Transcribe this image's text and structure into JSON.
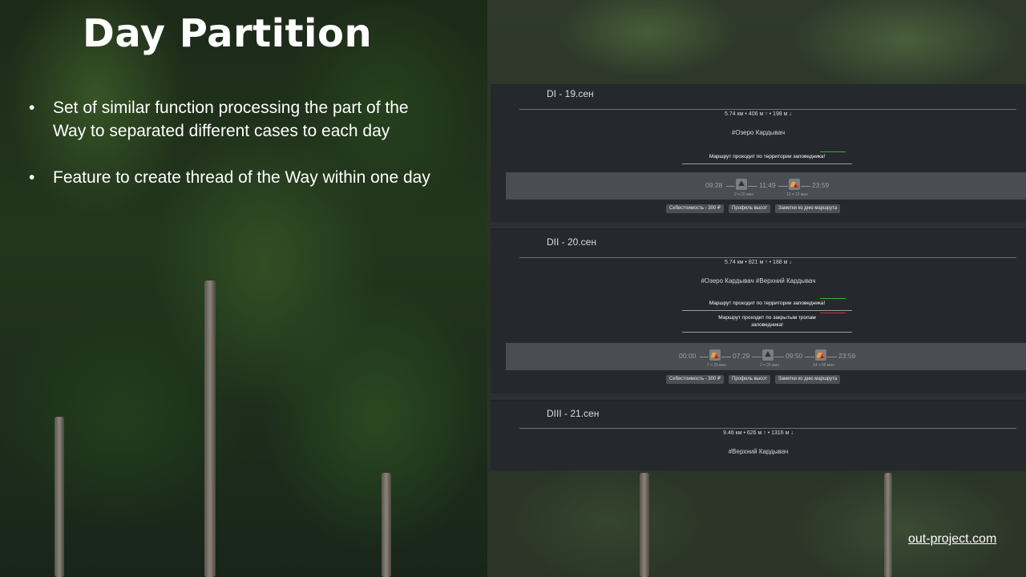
{
  "slide": {
    "title": "Day Partition",
    "bullets": [
      "Set of similar function processing the part of the Way to separated different cases to each day",
      "Feature to create thread of the Way within one day"
    ],
    "link": "out-project.com"
  },
  "screenshot": {
    "days": [
      {
        "title": "DI - 19.сен",
        "stats": "5.74 км • 406 м ↑ • 198 м ↓",
        "tags": "#Озеро Кардывач",
        "warnings": [
          {
            "text": "Маршрут проходит по территории заповедника!",
            "mark_color": "#3fae49"
          }
        ],
        "timeline": {
          "times": [
            "09:28",
            "11:49",
            "23:59"
          ],
          "durations": [
            "2 ч 20 мин",
            "12 ч 10 мин"
          ]
        },
        "buttons": [
          "Себестоимость - 300 ₽",
          "Профиль высот",
          "Заметки ко дню маршрута"
        ]
      },
      {
        "title": "DII - 20.сен",
        "stats": "5.74 км • 821 м ↑ • 188 м ↓",
        "tags": "#Озеро Кардывач #Верхний Кардывач",
        "warnings": [
          {
            "text": "Маршрут проходит по территории заповедника!",
            "mark_color": "#3fae49"
          },
          {
            "text": "Маршрут проходит по закрытым тропам заповедника!",
            "mark_color": "#c0392b"
          }
        ],
        "timeline": {
          "times": [
            "00:00",
            "07:29",
            "09:50",
            "23:59"
          ],
          "durations": [
            "7 ч 29 мин",
            "2 ч 20 мин",
            "14 ч 09 мин"
          ]
        },
        "buttons": [
          "Себестоимость - 300 ₽",
          "Профиль высот",
          "Заметки ко дню маршрута"
        ]
      },
      {
        "title": "DIII - 21.сен",
        "stats": "9.46 км • 626 м ↑ • 1316 м ↓",
        "tags": "#Верхний Кардывач"
      }
    ]
  }
}
